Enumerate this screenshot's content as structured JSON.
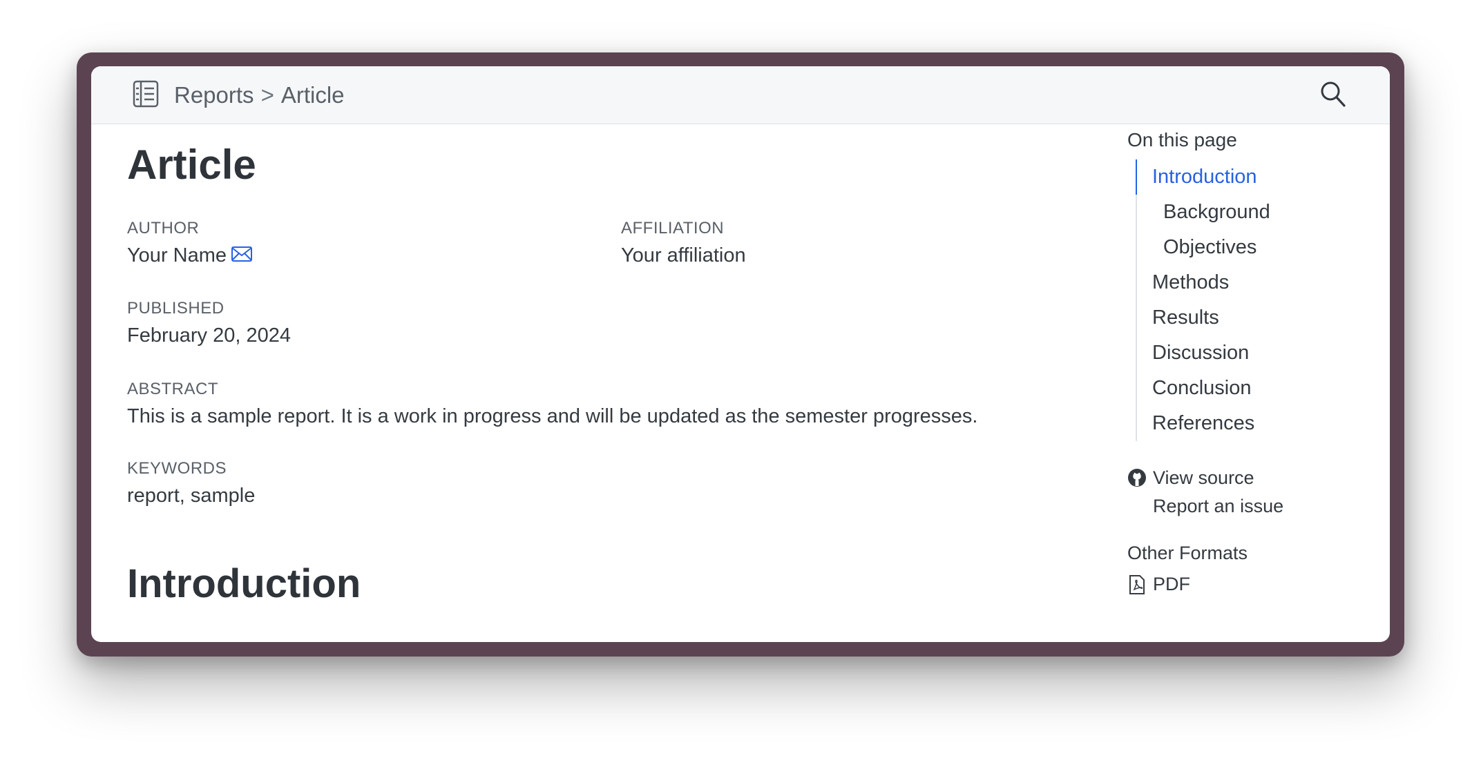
{
  "breadcrumb": {
    "parent": "Reports",
    "separator": ">",
    "current": "Article"
  },
  "article": {
    "title": "Article",
    "author": {
      "label": "AUTHOR",
      "name": "Your Name"
    },
    "affiliation": {
      "label": "AFFILIATION",
      "value": "Your affiliation"
    },
    "published": {
      "label": "PUBLISHED",
      "value": "February 20, 2024"
    },
    "abstract": {
      "label": "ABSTRACT",
      "text": "This is a sample report. It is a work in progress and will be updated as the semester progresses."
    },
    "keywords": {
      "label": "KEYWORDS",
      "value": "report, sample"
    },
    "section_heading": "Introduction"
  },
  "toc": {
    "title": "On this page",
    "items": [
      {
        "label": "Introduction",
        "active": true
      },
      {
        "label": "Background"
      },
      {
        "label": "Objectives"
      },
      {
        "label": "Methods"
      },
      {
        "label": "Results"
      },
      {
        "label": "Discussion"
      },
      {
        "label": "Conclusion"
      },
      {
        "label": "References"
      }
    ]
  },
  "links": {
    "view_source": "View source",
    "report_issue": "Report an issue"
  },
  "other_formats": {
    "title": "Other Formats",
    "pdf": "PDF"
  },
  "icons": {
    "sidebar": "sidebar-toggle-icon",
    "search": "search-icon",
    "email": "mail-icon",
    "github": "github-icon",
    "pdf": "pdf-file-icon"
  },
  "colors": {
    "accent": "#2761e3",
    "frame": "#5c4352",
    "topbar": "#f6f7f9"
  }
}
